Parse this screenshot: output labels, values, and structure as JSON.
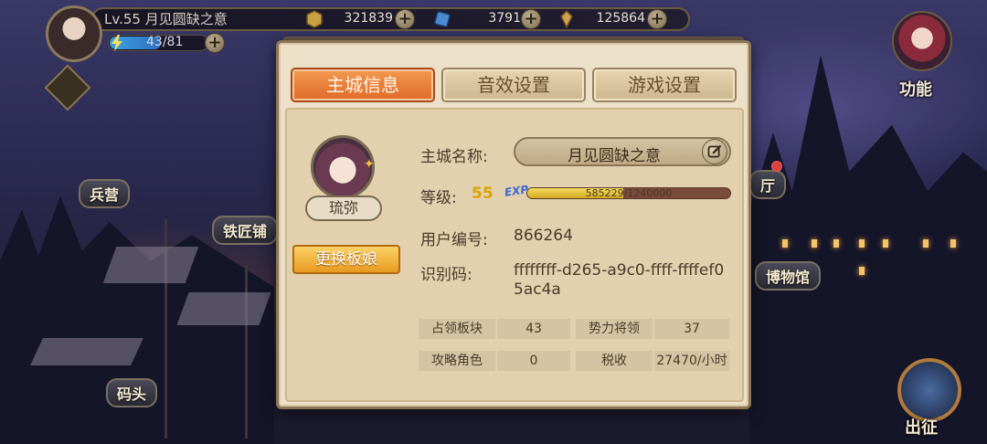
{
  "hud": {
    "level_name": "Lv.55 月见圆缺之意",
    "gold": "321839",
    "tickets": "3791",
    "crystals": "125864",
    "stamina": "43/81",
    "stamina_fraction": 0.53
  },
  "map_labels": {
    "barracks": "兵营",
    "smithy": "铁匠铺",
    "dock": "码头",
    "museum": "博物馆",
    "hall": "厅"
  },
  "right_buttons": {
    "function": "功能",
    "sortie": "出征"
  },
  "tabs": [
    {
      "label": "主城信息",
      "active": true
    },
    {
      "label": "音效设置",
      "active": false
    },
    {
      "label": "游戏设置",
      "active": false
    }
  ],
  "character": {
    "name": "琉弥",
    "change_button": "更换板娘"
  },
  "info": {
    "city_name_label": "主城名称:",
    "city_name": "月见圆缺之意",
    "level_label": "等级:",
    "level": "55",
    "exp_tag": "EXP",
    "exp_text": "585229/1240000",
    "exp_fraction": 0.472,
    "user_id_label": "用户编号:",
    "user_id": "866264",
    "ident_label": "识别码:",
    "ident": "ffffffff-d265-a9c0-ffff-ffffef05ac4a"
  },
  "stats": [
    {
      "label": "占领板块",
      "value": "43"
    },
    {
      "label": "势力将领",
      "value": "37"
    },
    {
      "label": "攻略角色",
      "value": "0"
    },
    {
      "label": "税收",
      "value": "27470/小时"
    }
  ],
  "colors": {
    "tab_active": "#e06a2a",
    "exp_fill": "#d2a820",
    "level_value": "#d8a400",
    "change_button": "#e89a20"
  }
}
